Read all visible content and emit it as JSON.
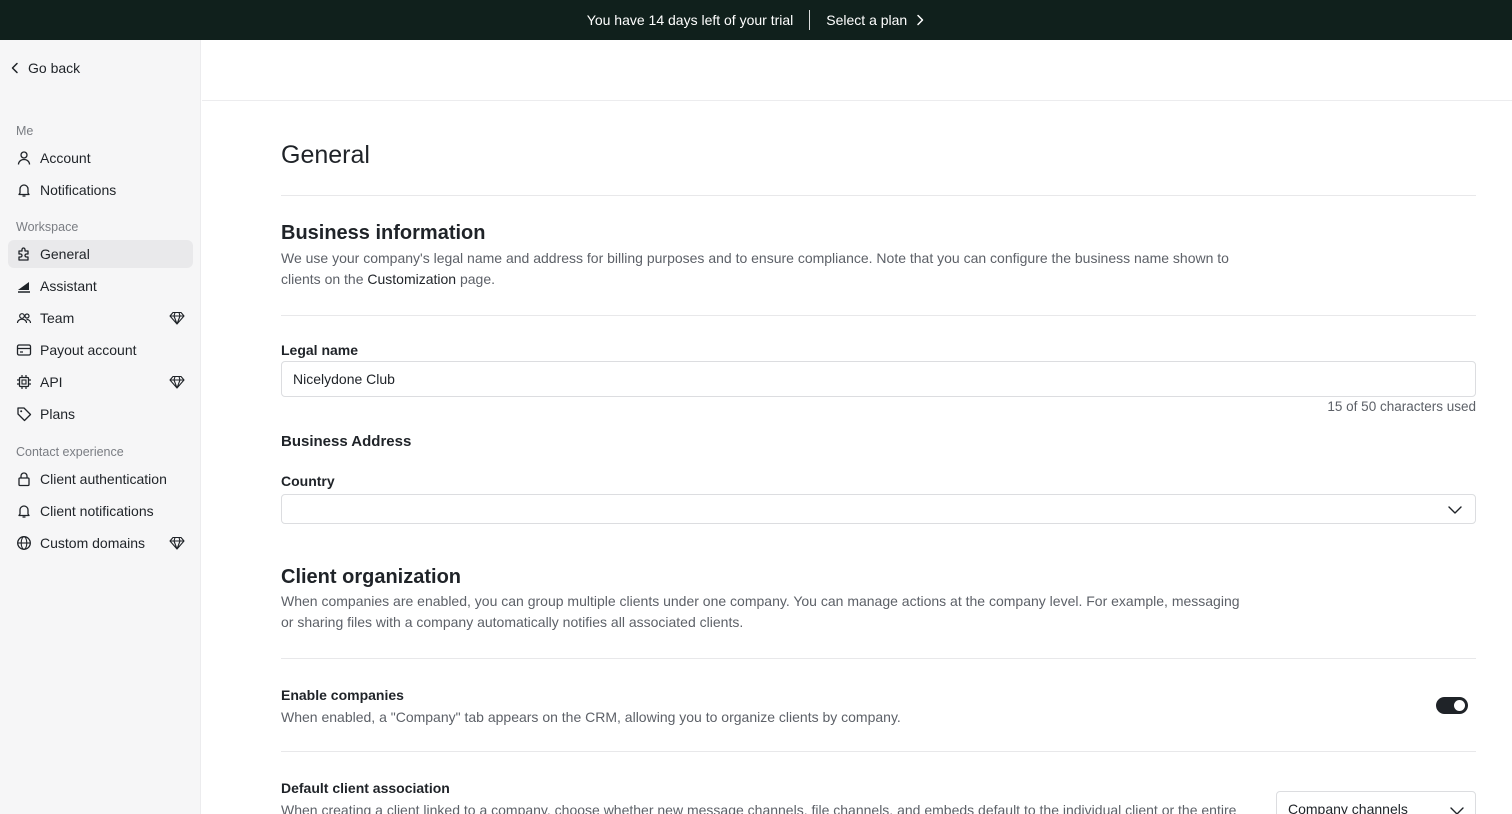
{
  "banner": {
    "trial_text": "You have 14 days left of your trial",
    "cta_label": "Select a plan",
    "background": "#10201c"
  },
  "sidebar": {
    "go_back_label": "Go back",
    "sections": {
      "me": "Me",
      "workspace": "Workspace",
      "contact": "Contact experience"
    },
    "items": [
      {
        "label": "Account",
        "icon": "user-icon"
      },
      {
        "label": "Notifications",
        "icon": "bell-icon"
      },
      {
        "label": "General",
        "icon": "puzzle-icon",
        "active": true
      },
      {
        "label": "Assistant",
        "icon": "assistant-icon"
      },
      {
        "label": "Team",
        "icon": "users-icon",
        "premium": true
      },
      {
        "label": "Payout account",
        "icon": "credit-card-icon"
      },
      {
        "label": "API",
        "icon": "chip-icon",
        "premium": true
      },
      {
        "label": "Plans",
        "icon": "tag-icon"
      },
      {
        "label": "Client authentication",
        "icon": "lock-icon"
      },
      {
        "label": "Client notifications",
        "icon": "bell-icon"
      },
      {
        "label": "Custom domains",
        "icon": "globe-icon",
        "premium": true
      }
    ]
  },
  "main": {
    "title": "General",
    "business": {
      "title": "Business information",
      "desc_before": "We use your company's legal name and address for billing purposes and to ensure compliance. Note that you can configure the business name shown to clients on the ",
      "desc_link": "Customization",
      "desc_after": " page.",
      "legal_name_label": "Legal name",
      "legal_name_value": "Nicelydone Club",
      "counter": "15 of 50 characters used",
      "address_heading": "Business Address",
      "country_label": "Country",
      "country_value": ""
    },
    "client_org": {
      "title": "Client organization",
      "desc": "When companies are enabled, you can group multiple clients under one company. You can manage actions at the company level. For example, messaging or sharing files with a company automatically notifies all associated clients.",
      "enable_title": "Enable companies",
      "enable_desc": "When enabled, a \"Company\" tab appears on the CRM, allowing you to organize clients by company.",
      "enable_on": true,
      "default_title": "Default client association",
      "default_desc": "When creating a client linked to a company, choose whether new message channels, file channels, and embeds default to the individual client or the entire",
      "default_value": "Company channels"
    }
  }
}
